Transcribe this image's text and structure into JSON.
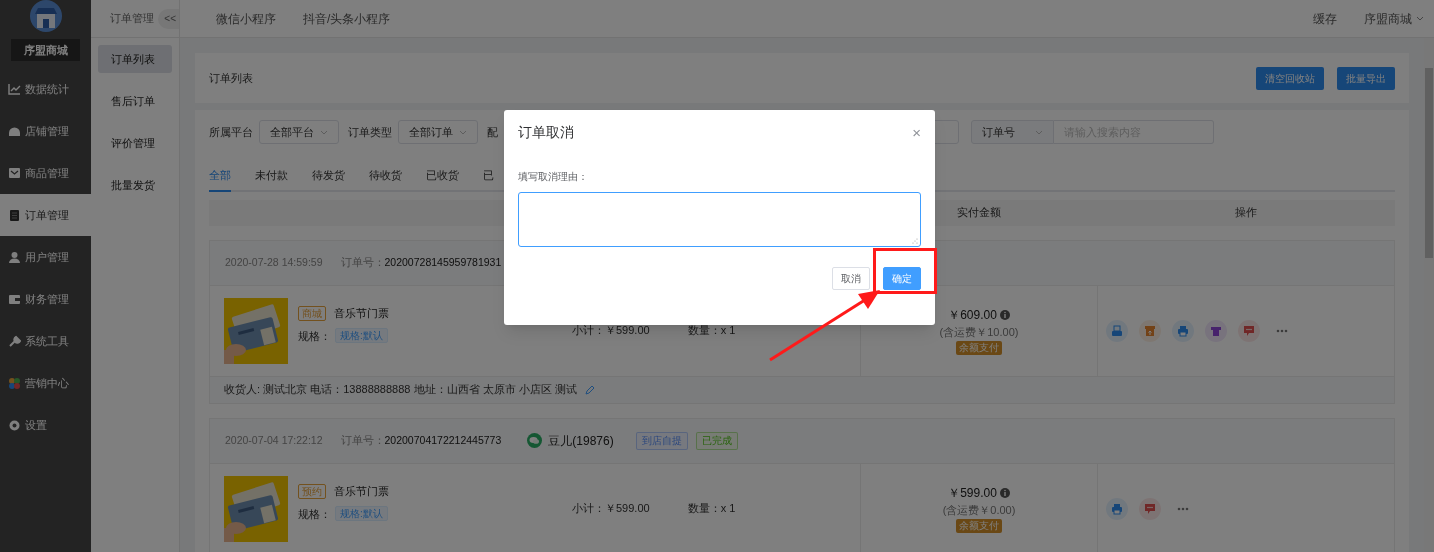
{
  "sidebar": {
    "brand": "序盟商城",
    "items": [
      {
        "label": "数据统计",
        "kind": "chart",
        "selected": false
      },
      {
        "label": "店铺管理",
        "kind": "shop",
        "selected": false
      },
      {
        "label": "商品管理",
        "kind": "goods",
        "selected": false
      },
      {
        "label": "订单管理",
        "kind": "orders",
        "selected": true
      },
      {
        "label": "用户管理",
        "kind": "user",
        "selected": false
      },
      {
        "label": "财务管理",
        "kind": "finance",
        "selected": false
      },
      {
        "label": "系统工具",
        "kind": "tools",
        "selected": false
      },
      {
        "label": "营销中心",
        "kind": "marketing",
        "selected": false
      },
      {
        "label": "设置",
        "kind": "settings",
        "selected": false
      }
    ]
  },
  "submenu": {
    "title": "订单管理",
    "collapse": "<<",
    "items": [
      {
        "label": "订单列表",
        "selected": true
      },
      {
        "label": "售后订单",
        "selected": false
      },
      {
        "label": "评价管理",
        "selected": false
      },
      {
        "label": "批量发货",
        "selected": false
      }
    ]
  },
  "top_bar": {
    "tabs": [
      "微信小程序",
      "抖音/头条小程序"
    ],
    "cache": "缓存",
    "account": "序盟商城"
  },
  "panel": {
    "title": "订单列表",
    "buttons": [
      "清空回收站",
      "批量导出"
    ]
  },
  "filters": [
    {
      "label": "所属平台",
      "value": "全部平台"
    },
    {
      "label": "订单类型",
      "value": "全部订单"
    },
    {
      "label": "配"
    }
  ],
  "search": {
    "field": "订单号",
    "placeholder": "请输入搜索内容"
  },
  "status_tabs": [
    {
      "label": "全部",
      "selected": true
    },
    {
      "label": "未付款",
      "selected": false
    },
    {
      "label": "待发货",
      "selected": false
    },
    {
      "label": "待收货",
      "selected": false
    },
    {
      "label": "已收货",
      "selected": false
    },
    {
      "label": "已",
      "selected": false
    }
  ],
  "table": {
    "columns": [
      "实付金额",
      "操作"
    ]
  },
  "orders": [
    {
      "time": "2020-07-28 14:59:59",
      "order_no_label": "订单号：",
      "order_no": "20200728145959781931",
      "product": {
        "tag": "商城",
        "name": "音乐节门票",
        "spec_label": "规格：",
        "spec": "规格:默认",
        "subtotal_label": "小计：",
        "subtotal": "￥599.00",
        "qty_label": "数量：",
        "qty": "x 1"
      },
      "amount": "￥609.00",
      "shipping": "(含运费￥10.00)",
      "payment": "余额支付",
      "actions": [
        {
          "kind": "receipt"
        },
        {
          "kind": "box"
        },
        {
          "kind": "printer"
        },
        {
          "kind": "shirt"
        },
        {
          "kind": "message"
        },
        {
          "kind": "more"
        }
      ],
      "address": "收货人: 测试北京 电话：13888888888 地址：山西省 太原市 小店区 测试"
    },
    {
      "time": "2020-07-04 17:22:12",
      "order_no_label": "订单号：",
      "order_no": "20200704172212445773",
      "buyer": "豆儿(19876)",
      "tags": [
        {
          "label": "到店自提",
          "kind": "delivery"
        },
        {
          "label": "已完成",
          "kind": "status"
        }
      ],
      "product": {
        "tag": "预约",
        "name": "音乐节门票",
        "spec_label": "规格：",
        "spec": "规格:默认",
        "subtotal_label": "小计：",
        "subtotal": "￥599.00",
        "qty_label": "数量：",
        "qty": "x 1"
      },
      "amount": "￥599.00",
      "shipping": "(含运费￥0.00)",
      "payment": "余额支付",
      "actions": [
        {
          "kind": "printer"
        },
        {
          "kind": "message"
        },
        {
          "kind": "more"
        }
      ]
    }
  ],
  "modal": {
    "title": "订单取消",
    "close": "×",
    "label": "填写取消理由：",
    "focused": true,
    "buttons": [
      "取消",
      "确定"
    ]
  }
}
